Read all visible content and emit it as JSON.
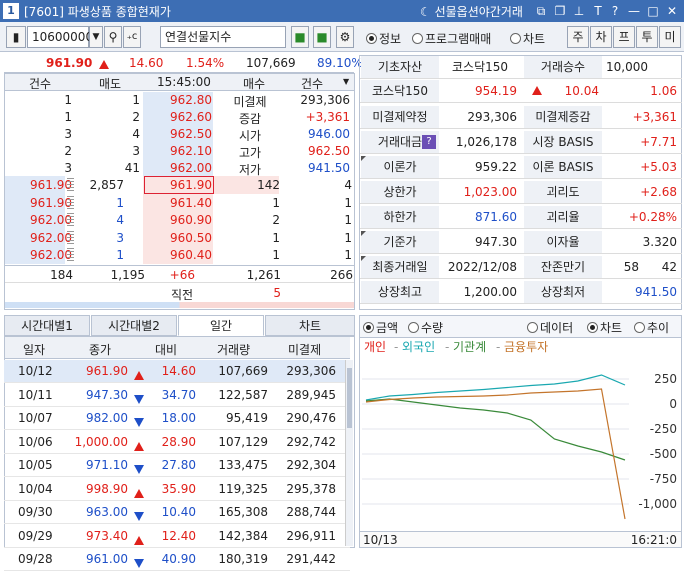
{
  "window": {
    "num": "1",
    "title": "[7601] 파생상품 종합현재가",
    "night_label": "선물옵션야간거래",
    "icons": [
      "link-icon",
      "copy-icon",
      "pin-icon",
      "font-icon",
      "help-icon",
      "minimize-icon",
      "maximize-icon",
      "close-icon"
    ]
  },
  "toolbar": {
    "code": "10600000",
    "name": "연결선물지수",
    "radios": [
      {
        "label": "정보",
        "on": true
      },
      {
        "label": "프로그램매매",
        "on": false
      },
      {
        "label": "차트",
        "on": false
      }
    ],
    "buttons": [
      "주",
      "차",
      "프",
      "투",
      "미"
    ]
  },
  "summary": {
    "price": "961.90",
    "change": "14.60",
    "pct": "1.54%",
    "volume": "107,669",
    "strength": "89.10%"
  },
  "orderbook": {
    "headers": [
      "건수",
      "매도",
      "15:45:00",
      "매수",
      "건수"
    ],
    "asks": [
      {
        "cnt": "1",
        "qty": "1",
        "price": "962.80",
        "label": "미결제",
        "val": "293,306"
      },
      {
        "cnt": "1",
        "qty": "2",
        "price": "962.60",
        "label": "증감",
        "val": "+3,361"
      },
      {
        "cnt": "3",
        "qty": "4",
        "price": "962.50",
        "label": "시가",
        "val": "946.00"
      },
      {
        "cnt": "2",
        "qty": "3",
        "price": "962.10",
        "label": "고가",
        "val": "962.50"
      },
      {
        "cnt": "3",
        "qty": "41",
        "price": "962.00",
        "label": "저가",
        "val": "941.50"
      }
    ],
    "bids": [
      {
        "tick_price": "961.90",
        "tick_qty": "2,857",
        "price": "961.90",
        "qty": "142",
        "cnt": "4"
      },
      {
        "tick_price": "961.90",
        "tick_qty": "1",
        "price": "961.40",
        "qty": "1",
        "cnt": "1"
      },
      {
        "tick_price": "962.00",
        "tick_qty": "4",
        "price": "960.90",
        "qty": "2",
        "cnt": "1"
      },
      {
        "tick_price": "962.00",
        "tick_qty": "3",
        "price": "960.50",
        "qty": "1",
        "cnt": "1"
      },
      {
        "tick_price": "962.00",
        "tick_qty": "1",
        "price": "960.40",
        "qty": "1",
        "cnt": "1"
      }
    ],
    "totals": {
      "ask_cnt": "184",
      "ask_qty": "1,195",
      "diff": "+66",
      "bid_qty": "1,261",
      "bid_cnt": "266"
    },
    "last": {
      "label": "직전",
      "val": "5"
    }
  },
  "info": {
    "base_label": "기초자산",
    "base_val": "코스닥150",
    "mult_label": "거래승수",
    "mult_val": "10,000",
    "idx_label": "코스닥150",
    "idx_price": "954.19",
    "idx_change": "10.04",
    "idx_pct": "1.06",
    "rows": [
      {
        "l1": "미결제약정",
        "v1": "293,306",
        "l2": "미결제증감",
        "v2": "+3,361"
      },
      {
        "l1": "거래대금",
        "v1": "1,026,178",
        "l2": "시장 BASIS",
        "v2": "+7.71"
      },
      {
        "l1": "이론가",
        "v1": "959.22",
        "l2": "이론 BASIS",
        "v2": "+5.03"
      },
      {
        "l1": "상한가",
        "v1": "1,023.00",
        "l2": "괴리도",
        "v2": "+2.68"
      },
      {
        "l1": "하한가",
        "v1": "871.60",
        "l2": "괴리율",
        "v2": "+0.28%"
      },
      {
        "l1": "기준가",
        "v1": "947.30",
        "l2": "이자율",
        "v2": "3.320"
      },
      {
        "l1": "최종거래일",
        "v1": "2022/12/08",
        "l2": "잔존만기",
        "v2a": "58",
        "v2": "42"
      },
      {
        "l1": "상장최고",
        "v1": "1,200.00",
        "l2": "상장최저",
        "v2": "941.50"
      }
    ]
  },
  "tabs": [
    "시간대별1",
    "시간대별2",
    "일간",
    "차트"
  ],
  "grid": {
    "headers": [
      "일자",
      "종가",
      "대비",
      "거래량",
      "미결제"
    ],
    "rows": [
      {
        "date": "10/12",
        "close": "961.90",
        "dir": "up",
        "chg": "14.60",
        "vol": "107,669",
        "oi": "293,306"
      },
      {
        "date": "10/11",
        "close": "947.30",
        "dir": "dn",
        "chg": "34.70",
        "vol": "122,587",
        "oi": "289,945"
      },
      {
        "date": "10/07",
        "close": "982.00",
        "dir": "dn",
        "chg": "18.00",
        "vol": "95,419",
        "oi": "290,476"
      },
      {
        "date": "10/06",
        "close": "1,000.00",
        "dir": "up",
        "chg": "28.90",
        "vol": "107,129",
        "oi": "292,742"
      },
      {
        "date": "10/05",
        "close": "971.10",
        "dir": "dn",
        "chg": "27.80",
        "vol": "133,475",
        "oi": "292,304"
      },
      {
        "date": "10/04",
        "close": "998.90",
        "dir": "up",
        "chg": "35.90",
        "vol": "119,325",
        "oi": "295,378"
      },
      {
        "date": "09/30",
        "close": "963.00",
        "dir": "dn",
        "chg": "10.40",
        "vol": "165,308",
        "oi": "288,744"
      },
      {
        "date": "09/29",
        "close": "973.40",
        "dir": "up",
        "chg": "12.40",
        "vol": "142,384",
        "oi": "296,911"
      },
      {
        "date": "09/28",
        "close": "961.00",
        "dir": "dn",
        "chg": "40.90",
        "vol": "180,319",
        "oi": "291,442"
      }
    ]
  },
  "investor": {
    "radios_left": [
      {
        "label": "금액",
        "on": true
      },
      {
        "label": "수량",
        "on": false
      }
    ],
    "radios_right": [
      {
        "label": "데이터",
        "on": false
      },
      {
        "label": "차트",
        "on": true
      },
      {
        "label": "추이",
        "on": false
      }
    ],
    "date": "10/13",
    "time": "16:21:0"
  },
  "chart_data": {
    "type": "line",
    "title": "",
    "xlabel": "",
    "ylabel": "",
    "y_ticks": [
      250,
      0,
      -250,
      -500,
      -750,
      -1000
    ],
    "ylim": [
      -1200,
      450
    ],
    "grid": true,
    "legend": "top-left",
    "series": [
      {
        "name": "개인",
        "color": "#e0201a",
        "values": [
          0,
          0,
          0,
          0,
          0,
          0,
          0,
          0,
          0,
          0,
          0,
          0
        ]
      },
      {
        "name": "외국인",
        "color": "#1aa8b0",
        "values": [
          40,
          80,
          95,
          115,
          130,
          145,
          165,
          185,
          200,
          230,
          290,
          190
        ]
      },
      {
        "name": "기관계",
        "color": "#3a8a3a",
        "values": [
          30,
          50,
          20,
          -10,
          -40,
          -60,
          -90,
          -160,
          -350,
          -420,
          -480,
          -560
        ]
      },
      {
        "name": "금융투자",
        "color": "#c4752c",
        "values": [
          20,
          45,
          60,
          70,
          75,
          80,
          90,
          110,
          120,
          130,
          150,
          -1150
        ]
      }
    ]
  }
}
